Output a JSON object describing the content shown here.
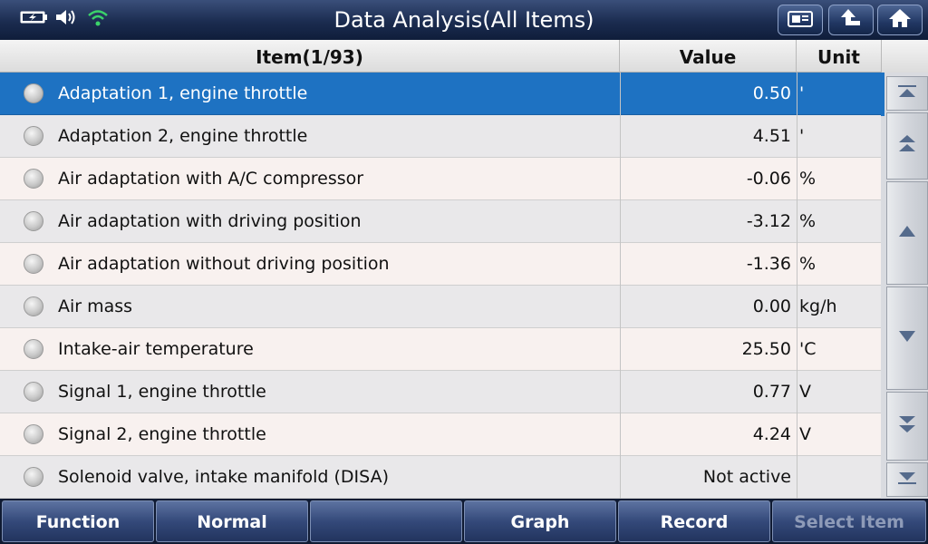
{
  "header": {
    "title": "Data Analysis(All Items)",
    "icons": [
      "battery-icon",
      "speaker-icon",
      "wifi-icon",
      "print-screen-icon",
      "back-icon",
      "home-icon"
    ]
  },
  "table": {
    "headers": {
      "item": "Item(1/93)",
      "value": "Value",
      "unit": "Unit"
    },
    "rows": [
      {
        "item": "Adaptation 1, engine throttle",
        "value": "0.50",
        "unit": "'"
      },
      {
        "item": "Adaptation 2, engine throttle",
        "value": "4.51",
        "unit": "'"
      },
      {
        "item": "Air adaptation with A/C compressor",
        "value": "-0.06",
        "unit": "%"
      },
      {
        "item": "Air adaptation with driving position",
        "value": "-3.12",
        "unit": "%"
      },
      {
        "item": "Air adaptation without driving position",
        "value": "-1.36",
        "unit": "%"
      },
      {
        "item": "Air mass",
        "value": "0.00",
        "unit": "kg/h"
      },
      {
        "item": "Intake-air temperature",
        "value": "25.50",
        "unit": "'C"
      },
      {
        "item": "Signal 1, engine throttle",
        "value": "0.77",
        "unit": "V"
      },
      {
        "item": "Signal 2, engine throttle",
        "value": "4.24",
        "unit": "V"
      },
      {
        "item": "Solenoid valve, intake manifold (DISA)",
        "value": "Not active",
        "unit": ""
      }
    ]
  },
  "scrollbar": {
    "buttons": [
      "scroll-top-icon",
      "page-up-icon",
      "line-up-icon",
      "line-down-icon",
      "page-down-icon",
      "scroll-bottom-icon"
    ]
  },
  "footer": {
    "buttons": [
      "Function",
      "Normal",
      "",
      "Graph",
      "Record",
      "Select Item"
    ]
  },
  "colors": {
    "selected_row": "#1e72c2",
    "header_bg": "#1b2c50",
    "footer_btn": "#34497a"
  }
}
